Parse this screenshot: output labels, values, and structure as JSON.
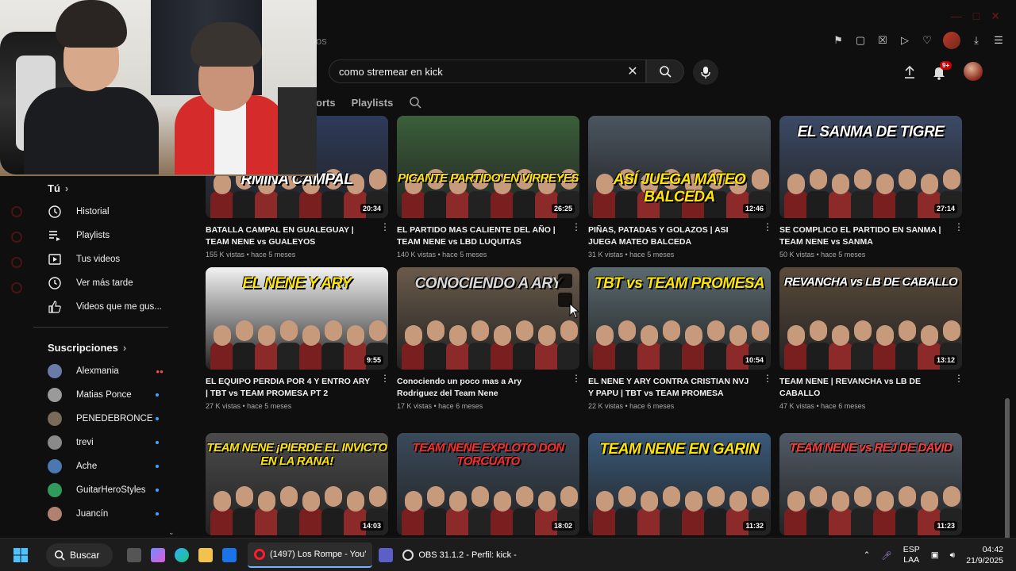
{
  "browser": {
    "tab_title_fragment": "os"
  },
  "youtube": {
    "search": {
      "value": "como stremear en kick"
    },
    "notification_badge": "9+",
    "channel_tabs": [
      "orts",
      "Playlists"
    ]
  },
  "sidebar": {
    "you_label": "Tú",
    "items": [
      {
        "label": "Historial",
        "icon": "history-icon"
      },
      {
        "label": "Playlists",
        "icon": "playlists-icon"
      },
      {
        "label": "Tus videos",
        "icon": "your-videos-icon"
      },
      {
        "label": "Ver más tarde",
        "icon": "watch-later-icon"
      },
      {
        "label": "Videos que me gus...",
        "icon": "liked-videos-icon"
      }
    ],
    "subscriptions_label": "Suscripciones",
    "subscriptions": [
      {
        "name": "Alexmania",
        "status": "live",
        "color": "#6a7ba8"
      },
      {
        "name": "Matias Ponce",
        "status": "new",
        "color": "#9a9a9a"
      },
      {
        "name": "PENEDEBRONCE",
        "status": "new",
        "color": "#7a6a5a"
      },
      {
        "name": "trevi",
        "status": "new",
        "color": "#8a8a8a"
      },
      {
        "name": "Ache",
        "status": "new",
        "color": "#4a78b0"
      },
      {
        "name": "GuitarHeroStyles",
        "status": "new",
        "color": "#2f9a5a"
      },
      {
        "name": "Juancín",
        "status": "new",
        "color": "#b08070"
      }
    ]
  },
  "videos": [
    {
      "title": "BATALLA CAMPAL EN GUALEGUAY | TEAM NENE vs GUALEYOS",
      "meta": "155 K vistas • hace 5 meses",
      "duration": "20:34",
      "thumb_text": "RMINA CAMPAL",
      "bg": "#2d3a5a",
      "accent": "#ffffff"
    },
    {
      "title": "EL PARTIDO MAS CALIENTE DEL AÑO | TEAM NENE vs LBD LUQUITAS",
      "meta": "140 K vistas • hace 5 meses",
      "duration": "26:25",
      "thumb_text": "PICANTE PARTIDO EN VIRREYES",
      "bg": "#3b5f3a",
      "accent": "#ffe600"
    },
    {
      "title": "PIÑAS, PATADAS Y GOLAZOS | ASI JUEGA MATEO BALCEDA",
      "meta": "31 K vistas • hace 5 meses",
      "duration": "12:46",
      "thumb_text": "ASÍ JUEGA MATEO BALCEDA",
      "bg": "#4a5560",
      "accent": "#ffe600"
    },
    {
      "title": "SE COMPLICO EL PARTIDO EN SANMA | TEAM NENE vs SANMA",
      "meta": "50 K vistas • hace 5 meses",
      "duration": "27:14",
      "thumb_text": "EL SANMA DE TIGRE",
      "bg": "#3c4a66",
      "accent": "#ffffff"
    },
    {
      "title": "EL EQUIPO PERDIA POR 4 Y ENTRO ARY | TBT vs TEAM PROMESA PT 2",
      "meta": "27 K vistas • hace 5 meses",
      "duration": "9:55",
      "thumb_text": "EL NENE Y ARY",
      "bg": "#f2f2f2",
      "accent": "#ffe600"
    },
    {
      "title": "Conociendo un poco mas a Ary Rodriguez del Team Nene",
      "meta": "17 K vistas • hace 6 meses",
      "duration": "",
      "thumb_text": "CONOCIENDO A ARY",
      "bg": "#6a5a4a",
      "accent": "#d9d9d9"
    },
    {
      "title": "EL NENE Y ARY CONTRA CRISTIAN NVJ Y PAPU | TBT vs TEAM PROMESA",
      "meta": "22 K vistas • hace 6 meses",
      "duration": "10:54",
      "thumb_text": "TBT vs TEAM PROMESA",
      "bg": "#5a6a70",
      "accent": "#ffe600"
    },
    {
      "title": "TEAM NENE | REVANCHA vs LB DE CABALLO",
      "meta": "47 K vistas • hace 6 meses",
      "duration": "13:12",
      "thumb_text": "REVANCHA vs LB DE CABALLO",
      "bg": "#5a4a3a",
      "accent": "#ffffff"
    },
    {
      "title": "",
      "meta": "",
      "duration": "14:03",
      "thumb_text": "TEAM NENE ¡PIERDE EL INVICTO EN LA RANA!",
      "bg": "#4a4a4a",
      "accent": "#ffe600"
    },
    {
      "title": "",
      "meta": "",
      "duration": "18:02",
      "thumb_text": "TEAM NENE EXPLOTO DON TORCUATO",
      "bg": "#3a4a5a",
      "accent": "#ff2a2a"
    },
    {
      "title": "",
      "meta": "",
      "duration": "11:32",
      "thumb_text": "TEAM NENE EN GARIN",
      "bg": "#3a5a7a",
      "accent": "#ffe600"
    },
    {
      "title": "",
      "meta": "",
      "duration": "11:23",
      "thumb_text": "TEAM NENE vs REJ DE DAVID",
      "bg": "#505a66",
      "accent": "#ff3b3b"
    }
  ],
  "taskbar": {
    "search_label": "Buscar",
    "apps": [
      {
        "label": "(1497) Los Rompe - You'",
        "active": true
      },
      {
        "label": "OBS 31.1.2 - Perfil: kick -",
        "active": false
      }
    ],
    "lang_top": "ESP",
    "lang_bottom": "LAA",
    "time": "04:42",
    "date": "21/9/2025"
  },
  "colors": {
    "yt_bg": "#0f0f0f",
    "live_red": "#ff4e45",
    "new_blue": "#3ea6ff",
    "badge_red": "#cc0000"
  }
}
